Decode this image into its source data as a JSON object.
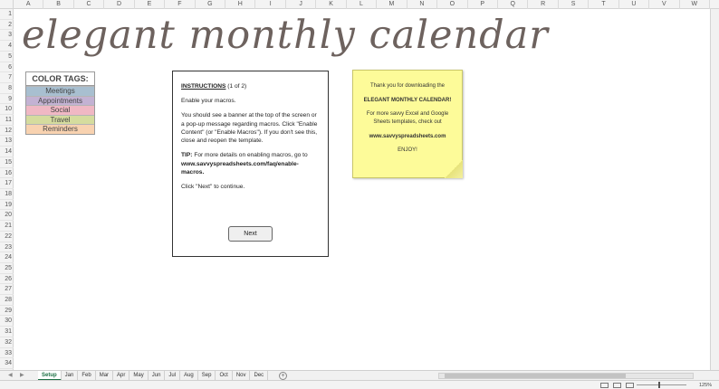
{
  "columns": [
    "A",
    "B",
    "C",
    "D",
    "E",
    "F",
    "G",
    "H",
    "I",
    "J",
    "K",
    "L",
    "M",
    "N",
    "O",
    "P",
    "Q",
    "R",
    "S",
    "T",
    "U",
    "V",
    "W"
  ],
  "rows": [
    "1",
    "2",
    "3",
    "4",
    "5",
    "6",
    "7",
    "8",
    "9",
    "10",
    "11",
    "12",
    "13",
    "14",
    "15",
    "16",
    "17",
    "18",
    "19",
    "20",
    "21",
    "22",
    "23",
    "24",
    "25",
    "26",
    "27",
    "28",
    "29",
    "30",
    "31",
    "32",
    "33",
    "34"
  ],
  "title": "elegant monthly calendar",
  "color_tags": {
    "heading": "COLOR TAGS:",
    "items": [
      {
        "label": "Meetings",
        "color": "#a8bfd0"
      },
      {
        "label": "Appointments",
        "color": "#c3b2d3"
      },
      {
        "label": "Social",
        "color": "#f0b8c4"
      },
      {
        "label": "Travel",
        "color": "#d5dc9e"
      },
      {
        "label": "Reminders",
        "color": "#f8d2b0"
      }
    ]
  },
  "instructions": {
    "heading": "INSTRUCTIONS",
    "page": "(1 of 2)",
    "p1": "Enable your macros.",
    "p2": "You should see a banner at the top of the screen or a pop-up message regarding macros.  Click \"Enable Content\" (or \"Enable Macros\").  If you don't see this, close and reopen the template.",
    "tip_label": "TIP:",
    "tip_text": "For more details on enabling macros, go to",
    "tip_url": "www.savvyspreadsheets.com/faq/enable-macros.",
    "p4": "Click \"Next\" to continue.",
    "next_label": "Next"
  },
  "note": {
    "line1": "Thank you for downloading the",
    "line2": "ELEGANT MONTHLY CALENDAR!",
    "line3": "For more savvy Excel and Google Sheets templates, check out",
    "line4": "www.savvyspreadsheets.com",
    "line5": "ENJOY!"
  },
  "tabs": [
    "Setup",
    "Jan",
    "Feb",
    "Mar",
    "Apr",
    "May",
    "Jun",
    "Jul",
    "Aug",
    "Sep",
    "Oct",
    "Nov",
    "Dec"
  ],
  "add_sheet": "+",
  "zoom": "125%",
  "colors": {
    "title": "#6d625e",
    "note_bg": "#fdfb99",
    "active_tab": "#1d7044"
  }
}
